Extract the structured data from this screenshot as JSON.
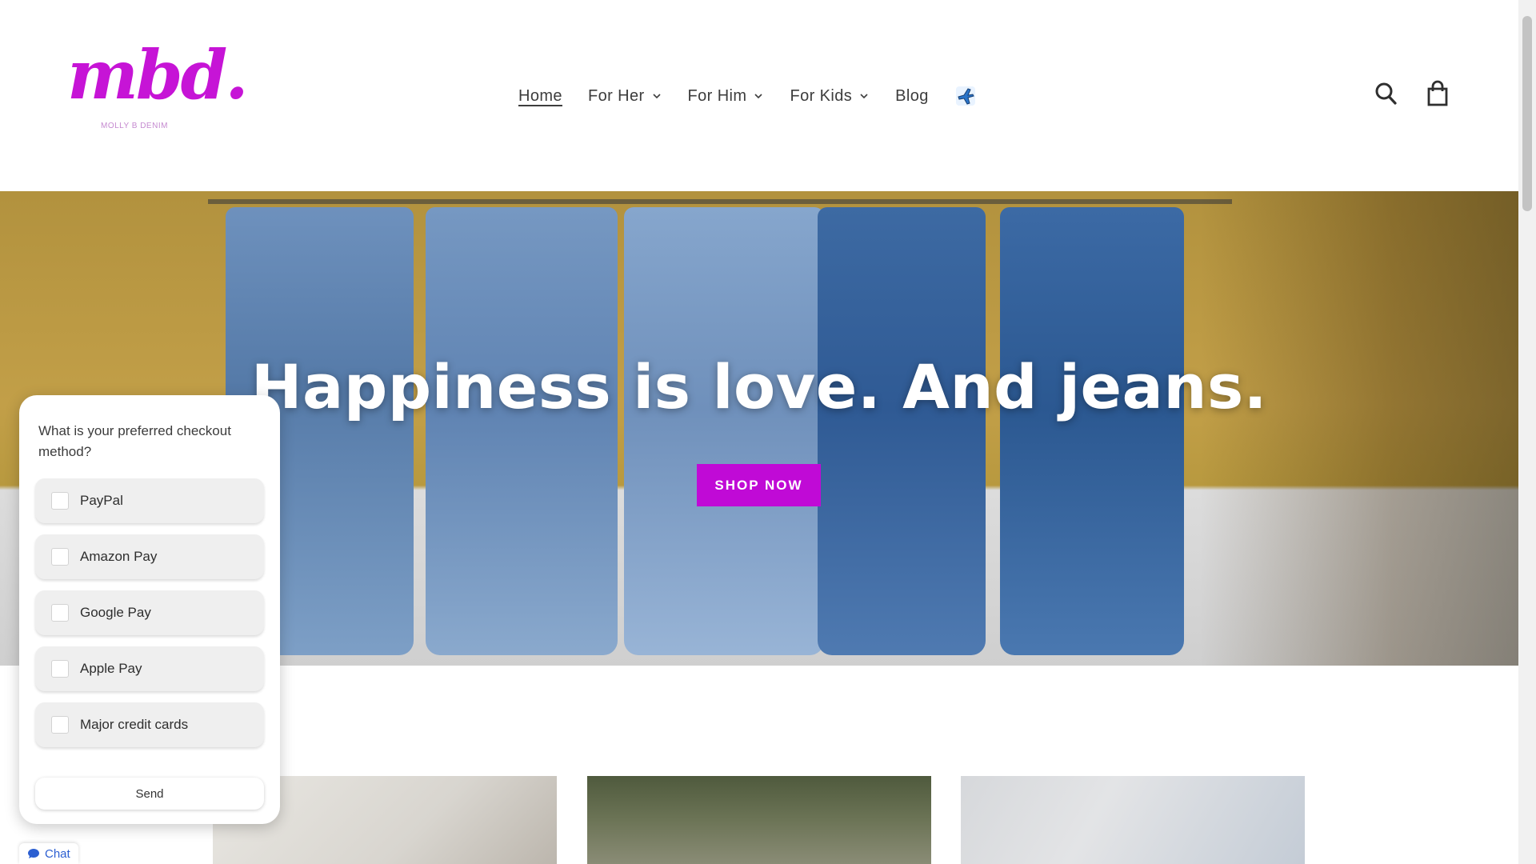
{
  "loading": {
    "progress": 0.2
  },
  "brand": {
    "logo_text": "mbd.",
    "logo_subtitle": "MOLLY B DENIM",
    "accent_color": "#c00ad6"
  },
  "nav": {
    "items": [
      {
        "label": "Home",
        "active": true,
        "dropdown": false
      },
      {
        "label": "For Her",
        "active": false,
        "dropdown": true
      },
      {
        "label": "For Him",
        "active": false,
        "dropdown": true
      },
      {
        "label": "For Kids",
        "active": false,
        "dropdown": true
      },
      {
        "label": "Blog",
        "active": false,
        "dropdown": false
      }
    ],
    "extra_icon": "airplane-icon"
  },
  "header_icons": [
    "search-icon",
    "cart-icon"
  ],
  "hero": {
    "title": "Happiness is love. And jeans.",
    "button_label": "SHOP NOW"
  },
  "survey": {
    "question": "What is your preferred checkout method?",
    "options": [
      "PayPal",
      "Amazon Pay",
      "Google Pay",
      "Apple Pay",
      "Major credit cards"
    ],
    "send_label": "Send"
  },
  "chat": {
    "label": "Chat",
    "icon": "chat-bubble-icon"
  }
}
